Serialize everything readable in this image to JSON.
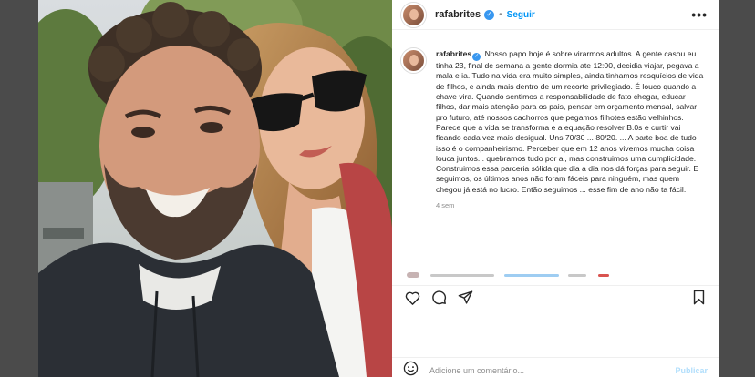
{
  "post": {
    "username": "rafabrites",
    "separator": "•",
    "follow_label": "Seguir",
    "more_label": "•••",
    "caption_username": "rafabrites",
    "caption_text": "Nosso papo hoje é sobre virarmos adultos. A gente casou eu tinha 23, final de semana a gente dormia ate 12:00, decidia viajar, pegava a mala e ia. Tudo na vida era muito simples, ainda tinhamos resquícios de vida de filhos, e ainda mais dentro de um recorte privilegiado. É louco quando a chave vira. Quando sentimos a responsabilidade de fato chegar, educar filhos, dar mais atenção para os pais, pensar em orçamento mensal, salvar pro futuro, até nossos cachorros que pegamos filhotes estão velhinhos. Parece que a vida se transforma e a equação resolver B.0s e curtir vai ficando cada vez mais desigual. Uns 70/30 ... 80/20. ... A parte boa de tudo isso é o companheirismo. Perceber que em 12 anos vivemos mucha coisa louca juntos... quebramos tudo por ai, mas construimos uma cumplicidade. Construimos essa parceria sólida que dia a dia nos dá forças para seguir. E seguimos, os últimos anos não foram fáceis para ninguém, mas quem chegou já está no lucro. Então seguimos ... esse fim de ano não ta fácil.",
    "time_ago": "4 sem",
    "comment_placeholder": "Adicione um comentário...",
    "publish_label": "Publicar"
  },
  "icons": {
    "verified": "verified-badge-icon",
    "like": "heart-icon",
    "comment": "comment-bubble-icon",
    "share": "send-icon",
    "save": "bookmark-icon",
    "emoji": "emoji-icon"
  },
  "colors": {
    "accent": "#0095f6",
    "verified": "#3897f0",
    "publish_disabled": "#b2dffc",
    "text": "#262626",
    "muted": "#8e8e8e"
  }
}
